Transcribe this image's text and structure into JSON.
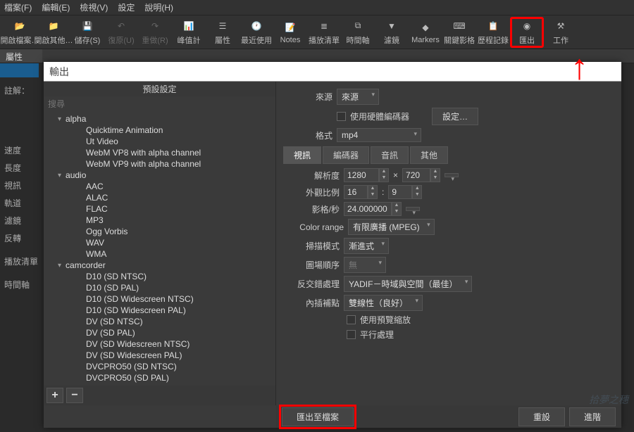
{
  "menubar": [
    "檔案(F)",
    "編輯(E)",
    "檢視(V)",
    "設定",
    "說明(H)"
  ],
  "toolbar": [
    {
      "icon": "📂",
      "label": "開啟檔案…",
      "enabled": true
    },
    {
      "icon": "📁",
      "label": "開啟其他…",
      "enabled": true
    },
    {
      "icon": "💾",
      "label": "儲存(S)",
      "enabled": true
    },
    {
      "icon": "↶",
      "label": "復原(U)",
      "enabled": false
    },
    {
      "icon": "↷",
      "label": "重做(R)",
      "enabled": false
    },
    {
      "icon": "📊",
      "label": "峰值計",
      "enabled": true
    },
    {
      "icon": "☰",
      "label": "屬性",
      "enabled": true
    },
    {
      "icon": "🕐",
      "label": "最近使用",
      "enabled": true
    },
    {
      "icon": "📝",
      "label": "Notes",
      "enabled": true
    },
    {
      "icon": "≣",
      "label": "播放清單",
      "enabled": true
    },
    {
      "icon": "⧉",
      "label": "時間軸",
      "enabled": true
    },
    {
      "icon": "▼",
      "label": "濾鏡",
      "enabled": true
    },
    {
      "icon": "◆",
      "label": "Markers",
      "enabled": true
    },
    {
      "icon": "⌨",
      "label": "關鍵影格",
      "enabled": true
    },
    {
      "icon": "📋",
      "label": "歷程記錄",
      "enabled": true
    },
    {
      "icon": "◉",
      "label": "匯出",
      "enabled": true,
      "highlight": true
    },
    {
      "icon": "⚒",
      "label": "工作",
      "enabled": true
    }
  ],
  "panel_label": "屬性",
  "left_labels": {
    "note": "註解：",
    "speed": "速度",
    "length": "長度",
    "video": "視訊",
    "track": "軌道",
    "filter_prefix": "濾鏡",
    "reverse": "反轉",
    "playlist": "播放清單",
    "timeline": "時間軸"
  },
  "export": {
    "title": "輸出",
    "preset_header": "預設設定",
    "search_placeholder": "搜尋",
    "categories": [
      {
        "name": "alpha",
        "items": [
          "Quicktime Animation",
          "Ut Video",
          "WebM VP8 with alpha channel",
          "WebM VP9 with alpha channel"
        ]
      },
      {
        "name": "audio",
        "items": [
          "AAC",
          "ALAC",
          "FLAC",
          "MP3",
          "Ogg Vorbis",
          "WAV",
          "WMA"
        ]
      },
      {
        "name": "camcorder",
        "items": [
          "D10 (SD NTSC)",
          "D10 (SD PAL)",
          "D10 (SD Widescreen NTSC)",
          "D10 (SD Widescreen PAL)",
          "DV (SD NTSC)",
          "DV (SD PAL)",
          "DV (SD Widescreen NTSC)",
          "DV (SD Widescreen PAL)",
          "DVCPRO50 (SD NTSC)",
          "DVCPRO50 (SD PAL)"
        ]
      }
    ],
    "from_label": "來源",
    "from_value": "來源",
    "hw_label": "使用硬體編碼器",
    "settings_btn": "設定…",
    "format_label": "格式",
    "format_value": "mp4",
    "tabs": [
      "視訊",
      "編碼器",
      "音訊",
      "其他"
    ],
    "res_label": "解析度",
    "res_w": "1280",
    "res_h": "720",
    "res_sep": "×",
    "aspect_label": "外觀比例",
    "aspect_w": "16",
    "aspect_h": "9",
    "aspect_sep": ":",
    "fps_label": "影格/秒",
    "fps_value": "24.000000",
    "colorrange_label": "Color range",
    "colorrange_value": "有限廣播 (MPEG)",
    "scan_label": "掃描模式",
    "scan_value": "漸進式",
    "fieldorder_label": "圖場順序",
    "fieldorder_value": "無",
    "deint_label": "反交錯處理",
    "deint_value": "YADIF－時域與空間（最佳）",
    "interp_label": "內插補點",
    "interp_value": "雙線性（良好）",
    "preview_scale": "使用預覽縮放",
    "parallel": "平行處理",
    "btn_export": "匯出至檔案",
    "btn_reset": "重設",
    "btn_advanced": "進階"
  },
  "watermark": "拾夢之穗"
}
